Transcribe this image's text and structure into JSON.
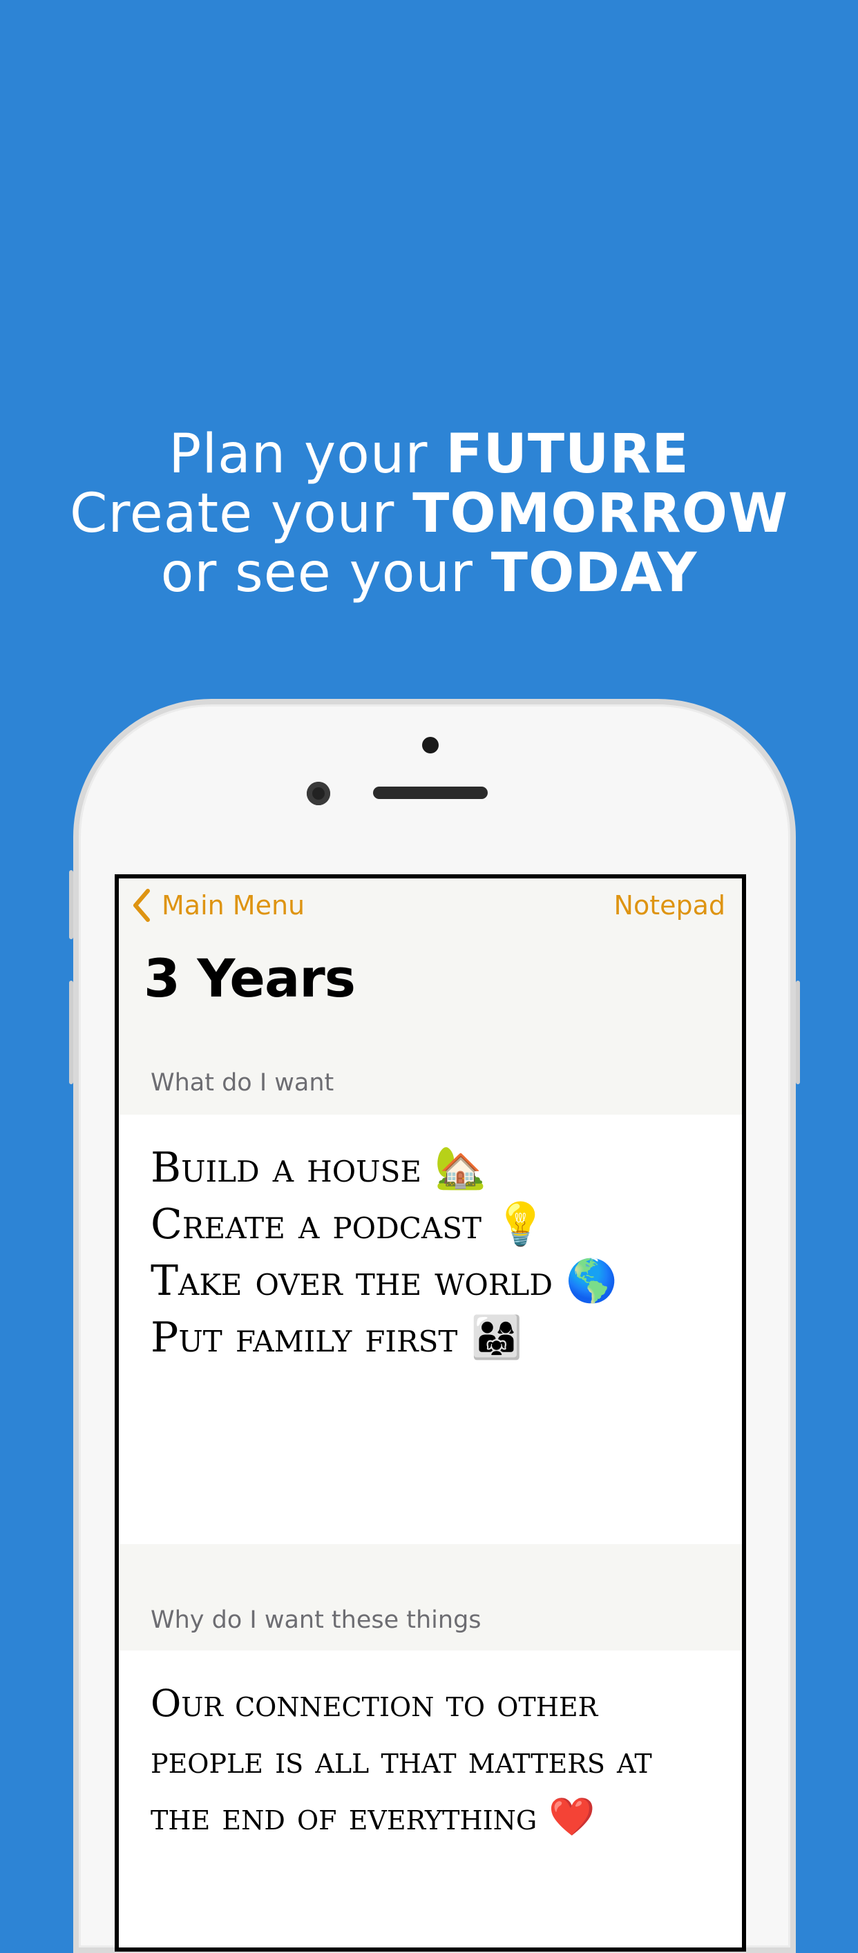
{
  "headline": {
    "line1_light": "Plan your ",
    "line1_bold": "FUTURE",
    "line2_light": "Create your ",
    "line2_bold": "TOMORROW",
    "line3_light": "or see your ",
    "line3_bold": "TODAY"
  },
  "nav": {
    "back_label": "Main Menu",
    "right_label": "Notepad",
    "accent_color": "#DE9412"
  },
  "page": {
    "title": "3 Years"
  },
  "sections": [
    {
      "header": "What do I want",
      "lines": [
        "Build a house 🏡",
        "Create a podcast 💡",
        "Take over the world 🌎",
        "Put family first 👨‍👩‍👧"
      ]
    },
    {
      "header": "Why do I want these things",
      "lines": [
        "Our connection to other",
        "people is all that matters at",
        "the end of everything ❤️"
      ]
    }
  ],
  "colors": {
    "background": "#2D84D5",
    "screen_bg": "#F6F6F3"
  }
}
